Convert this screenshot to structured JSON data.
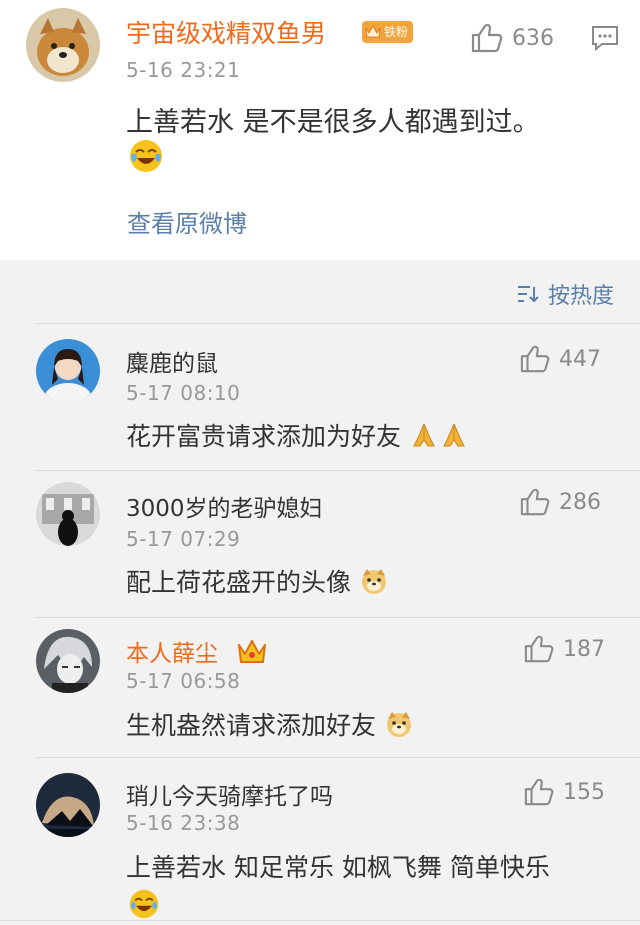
{
  "post": {
    "username": "宇宙级戏精双鱼男",
    "badge": "铁粉",
    "likes": "636",
    "time": "5-16 23:21",
    "text": "上善若水  是不是很多人都遇到过。",
    "emoji_icon": "laugh-cry-icon",
    "view_original": "查看原微博"
  },
  "sort": {
    "label": "按热度",
    "icon": "sort-icon"
  },
  "comments": [
    {
      "username": "麋鹿的鼠",
      "time": "5-17 08:10",
      "text": "花开富贵请求添加为好友",
      "likes": "447",
      "emoji": [
        "pray-icon",
        "pray-icon"
      ]
    },
    {
      "username": "3000岁的老驴媳妇",
      "time": "5-17 07:29",
      "text": "配上荷花盛开的头像",
      "likes": "286",
      "emoji": [
        "doge-icon"
      ]
    },
    {
      "username": "本人薛尘",
      "time": "5-17 06:58",
      "text": "生机盎然请求添加好友",
      "likes": "187",
      "emoji": [
        "doge-icon"
      ],
      "vip": true
    },
    {
      "username": "琑儿今天骑摩托了吗",
      "time": "5-16 23:38",
      "text": "上善若水 知足常乐 如枫飞舞 简单快乐",
      "likes": "155",
      "emoji": [
        "laugh-cry-icon"
      ]
    }
  ],
  "colors": {
    "orange": "#ef6b1a",
    "link": "#5b7faa",
    "gray": "#999999",
    "bg": "#f2f2f2"
  }
}
